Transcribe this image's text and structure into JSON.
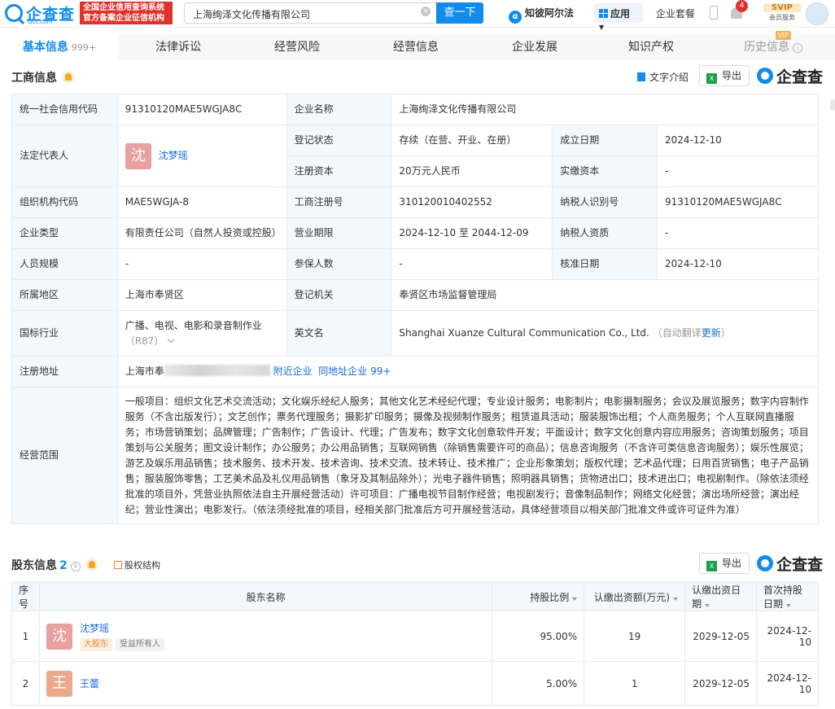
{
  "topbar": {
    "logo_name": "企查查",
    "logo_sub": "Qcc.com",
    "badge_line1": "全国企业信用查询系统",
    "badge_line2": "官方备案企业征信机构",
    "search_value": "上海绚泽文化传播有限公司",
    "search_button": "查一下",
    "zhibeier": "知彼阿尔法",
    "apps": "应用",
    "taocan": "企业套餐",
    "bell_count": "4",
    "svip": "SVIP",
    "svip_sub": "会员服务"
  },
  "tabs": [
    {
      "label": "基本信息",
      "count": "999+"
    },
    {
      "label": "法律诉讼"
    },
    {
      "label": "经营风险"
    },
    {
      "label": "经营信息"
    },
    {
      "label": "企业发展"
    },
    {
      "label": "知识产权"
    },
    {
      "label": "历史信息",
      "badge": "VIP"
    }
  ],
  "business": {
    "title": "工商信息",
    "text_intro": "文字介绍",
    "export": "导出",
    "brand": "企查查",
    "rows": {
      "credit_code_k": "统一社会信用代码",
      "credit_code_v": "91310120MAE5WGJA8C",
      "name_k": "企业名称",
      "name_v": "上海绚泽文化传播有限公司",
      "legal_k": "法定代表人",
      "legal_avatar": "沈",
      "legal_v": "沈梦瑶",
      "status_k": "登记状态",
      "status_v": "存续（在营、开业、在册）",
      "found_k": "成立日期",
      "found_v": "2024-12-10",
      "capital_k": "注册资本",
      "capital_v": "20万元人民币",
      "paid_k": "实缴资本",
      "paid_v": "-",
      "org_k": "组织机构代码",
      "org_v": "MAE5WGJA-8",
      "regno_k": "工商注册号",
      "regno_v": "310120010402552",
      "tax_k": "纳税人识别号",
      "tax_v": "91310120MAE5WGJA8C",
      "type_k": "企业类型",
      "type_v": "有限责任公司（自然人投资或控股）",
      "term_k": "营业期限",
      "term_v": "2024-12-10 至 2044-12-09",
      "taxq_k": "纳税人资质",
      "taxq_v": "-",
      "staff_k": "人员规模",
      "staff_v": "-",
      "insured_k": "参保人数",
      "insured_v": "-",
      "approve_k": "核准日期",
      "approve_v": "2024-12-10",
      "region_k": "所属地区",
      "region_v": "上海市奉贤区",
      "authority_k": "登记机关",
      "authority_v": "奉贤区市场监督管理局",
      "industry_k": "国标行业",
      "industry_v": "广播、电视、电影和录音制作业",
      "industry_code": "（R87）",
      "en_k": "英文名",
      "en_v": "Shanghai Xuanze Cultural Communication Co., Ltd.",
      "en_auto": "（自动翻译",
      "en_update": "更新",
      "en_close": "）",
      "addr_k": "注册地址",
      "addr_v": "上海市奉",
      "addr_nearby": "附近企业",
      "addr_same": "同地址企业 99+",
      "scope_k": "经营范围",
      "scope_v": "一般项目：组织文化艺术交流活动；文化娱乐经纪人服务；其他文化艺术经纪代理；专业设计服务；电影制片；电影摄制服务；会议及展览服务；数字内容制作服务（不含出版发行）；文艺创作；票务代理服务；摄影扩印服务；摄像及视频制作服务；租赁道具活动；服装服饰出租；个人商务服务；个人互联网直播服务；市场营销策划；品牌管理；广告制作；广告设计、代理；广告发布；数字文化创意软件开发；平面设计；数字文化创意内容应用服务；咨询策划服务；项目策划与公关服务；图文设计制作；办公服务；办公用品销售；互联网销售（除销售需要许可的商品）；信息咨询服务（不含许可类信息咨询服务）；娱乐性展览；游艺及娱乐用品销售；技术服务、技术开发、技术咨询、技术交流、技术转让、技术推广；企业形象策划；版权代理；艺术品代理；日用百货销售；电子产品销售；服装服饰零售；工艺美术品及礼仪用品销售（象牙及其制品除外）；光电子器件销售；照明器具销售；货物进出口；技术进出口；电视剧制作。（除依法须经批准的项目外，凭营业执照依法自主开展经营活动）许可项目：广播电视节目制作经营；电视剧发行；音像制品制作；网络文化经营；演出场所经营；演出经纪；营业性演出；电影发行。（依法须经批准的项目，经相关部门批准后方可开展经营活动，具体经营项目以相关部门批准文件或许可证件为准）"
    }
  },
  "shareholders": {
    "title": "股东信息",
    "count": "2",
    "structure": "股权结构",
    "export": "导出",
    "brand": "企查查",
    "headers": [
      "序号",
      "股东名称",
      "持股比例",
      "认缴出资额(万元)",
      "认缴出资日期",
      "首次持股日期"
    ],
    "rows": [
      {
        "no": "1",
        "avatar": "沈",
        "name": "沈梦瑶",
        "tag1": "大股东",
        "tag2": "受益所有人",
        "ratio": "95.00%",
        "amount": "19",
        "date": "2029-12-05",
        "first": "2024-12-10"
      },
      {
        "no": "2",
        "avatar": "王",
        "name": "王蕾",
        "ratio": "5.00%",
        "amount": "1",
        "date": "2029-12-05",
        "first": "2024-12-10"
      }
    ]
  },
  "colors": {
    "brand": "#128bed",
    "avatar_shen": "#e8a0a0",
    "avatar_wang": "#e9a98a"
  }
}
